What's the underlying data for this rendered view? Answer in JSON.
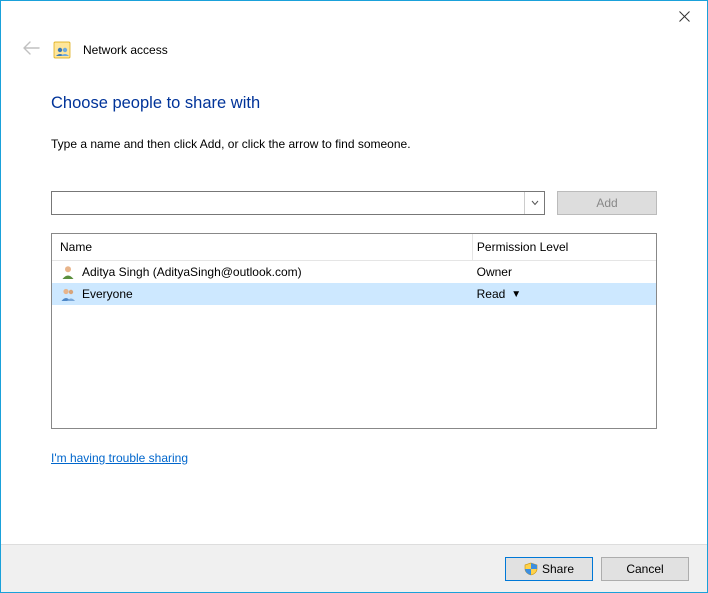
{
  "window": {
    "title": "Network access"
  },
  "heading": "Choose people to share with",
  "instruction": "Type a name and then click Add, or click the arrow to find someone.",
  "add": {
    "input_value": "",
    "button_label": "Add"
  },
  "table": {
    "headers": {
      "name": "Name",
      "permission": "Permission Level"
    },
    "rows": [
      {
        "name": "Aditya Singh (AdityaSingh@outlook.com)",
        "permission": "Owner",
        "selected": false
      },
      {
        "name": "Everyone",
        "permission": "Read",
        "selected": true
      }
    ]
  },
  "help_link": "I'm having trouble sharing",
  "footer": {
    "share": "Share",
    "cancel": "Cancel"
  }
}
